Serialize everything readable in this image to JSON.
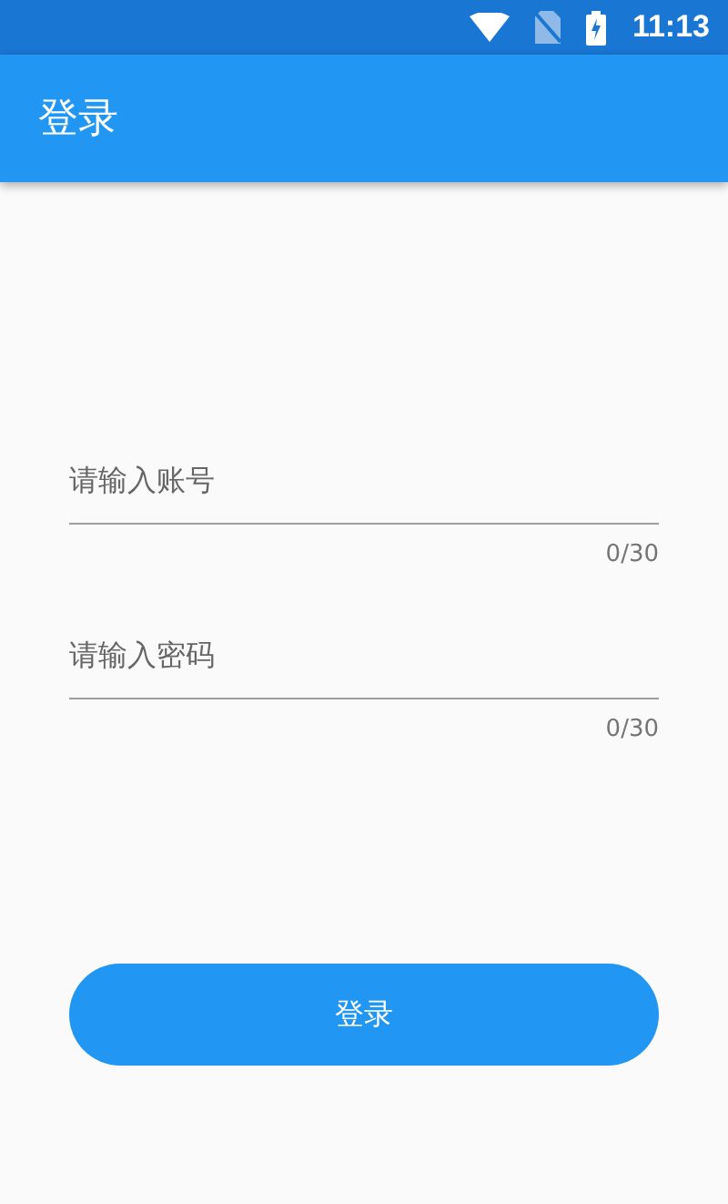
{
  "status_bar": {
    "time": "11:13"
  },
  "app_bar": {
    "title": "登录"
  },
  "fields": [
    {
      "placeholder": "请输入账号",
      "counter": "0/30"
    },
    {
      "placeholder": "请输入密码",
      "counter": "0/30"
    }
  ],
  "button": {
    "label": "登录"
  }
}
